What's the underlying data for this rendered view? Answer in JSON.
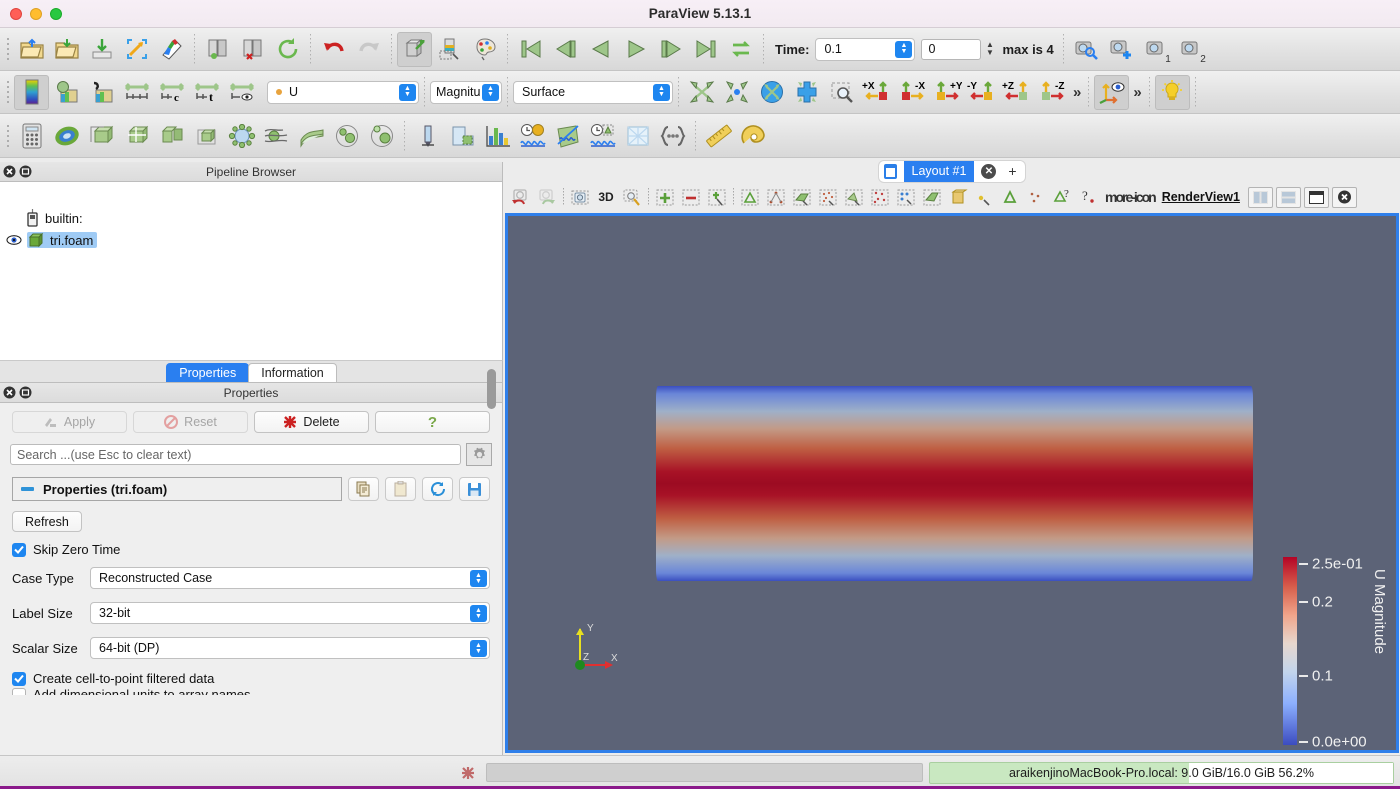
{
  "window": {
    "title": "ParaView 5.13.1"
  },
  "toolbar_main": {
    "time_label": "Time:",
    "time_value": "0.1",
    "frame_value": "0",
    "max_label": "max is 4",
    "camera1_sub": "1",
    "camera2_sub": "2",
    "icons": [
      "open-file-icon",
      "save-data-icon",
      "save-state-icon",
      "load-state-icon",
      "save-screenshot-icon",
      "connect-server-icon",
      "disconnect-server-icon",
      "reset-session-icon",
      "undo-icon",
      "redo-icon",
      "camera-undo-icon",
      "colormap-editor-icon",
      "edit-color-legend-icon",
      "first-frame-icon",
      "previous-frame-icon",
      "play-reverse-icon",
      "play-icon",
      "next-frame-icon",
      "last-frame-icon",
      "loop-icon",
      "magnify-camera-icon",
      "add-camera-icon",
      "camera-1-icon",
      "camera-2-icon"
    ]
  },
  "toolbar_active": {
    "array_value": "U",
    "component_value": "Magnitu",
    "representation_value": "Surface",
    "icons": [
      "color-map-icon",
      "rescale-to-data-icon",
      "rescale-custom-icon",
      "rescale-visible-icon",
      "rescale-over-time-icon",
      "rescale-temporal-icon",
      "rescale-visible-range-icon",
      "reset-camera-icon",
      "zoom-closest-icon",
      "rotate-90-icon",
      "center-axes-icon",
      "zoom-to-box-icon",
      "plus-x-icon",
      "minus-x-icon",
      "plus-y-icon",
      "minus-y-icon",
      "plus-z-icon",
      "minus-z-icon",
      "more-icon",
      "orientation-axes-icon",
      "more2-icon",
      "light-kit-icon"
    ]
  },
  "toolbar_filters": {
    "icons": [
      "calculator-icon",
      "contour-icon",
      "clip-icon",
      "slice-icon",
      "threshold-icon",
      "extract-subset-icon",
      "glyph-icon",
      "stream-tracer-icon",
      "warp-icon",
      "group-datasets-icon",
      "extract-level-icon",
      "probe-location-icon",
      "plot-over-line-icon",
      "histogram-icon",
      "plot-data-over-time-icon",
      "plot-on-intersection-icon",
      "plot-selection-over-time-icon",
      "annotate-time-icon",
      "python-calculator-icon",
      "ruler-icon",
      "protractor-icon"
    ]
  },
  "pipeline": {
    "panel_title": "Pipeline Browser",
    "items": [
      {
        "label": "builtin:",
        "icon": "server-icon",
        "selected": false,
        "eye": false
      },
      {
        "label": "tri.foam",
        "icon": "dataset-icon",
        "selected": true,
        "eye": true
      }
    ]
  },
  "properties": {
    "tabs": [
      {
        "label": "Properties",
        "selected": true
      },
      {
        "label": "Information",
        "selected": false
      }
    ],
    "panel_title": "Properties",
    "buttons": [
      {
        "label": "Apply",
        "icon": "apply-icon",
        "enabled": false
      },
      {
        "label": "Reset",
        "icon": "reset-icon",
        "enabled": false
      },
      {
        "label": "Delete",
        "icon": "delete-icon",
        "enabled": true
      },
      {
        "label": "?",
        "icon": "help-icon",
        "enabled": true
      }
    ],
    "search_placeholder": "Search ...(use Esc to clear text)",
    "gear_icon": "gear-icon",
    "group_title": "Properties (tri.foam)",
    "group_buttons": [
      "copy-icon",
      "paste-icon",
      "restore-defaults-icon",
      "save-defaults-icon"
    ],
    "refresh_label": "Refresh",
    "skip_zero_time": {
      "label": "Skip Zero Time",
      "checked": true
    },
    "fields": [
      {
        "label": "Case Type",
        "value": "Reconstructed Case"
      },
      {
        "label": "Label Size",
        "value": "32-bit"
      },
      {
        "label": "Scalar Size",
        "value": "64-bit (DP)"
      }
    ],
    "create_cell_to_point": {
      "label": "Create cell-to-point filtered data",
      "checked": true
    },
    "partial_row_label": "Add dimensional units to array names"
  },
  "layout": {
    "tab_label": "Layout #1",
    "close_icon": "close-icon",
    "add_icon": "plus-icon"
  },
  "viewtoolbar": {
    "view_name": "RenderView1",
    "mode_3d": "3D",
    "more_icon": "more-icon",
    "icons": [
      "undo-camera-icon",
      "redo-camera-icon",
      "adjust-camera-icon",
      "mode-3d-icon",
      "zoom-to-data-icon",
      "show-center-icon",
      "hide-center-icon",
      "pick-center-icon",
      "select-cells-icon",
      "select-points-icon",
      "select-surface-cells-icon",
      "select-surface-points-icon",
      "select-frustum-cells-icon",
      "select-frustum-points-icon",
      "select-block-icon",
      "interactive-select-icon",
      "hover-points-icon",
      "hover-cells-icon",
      "select-polygon-icon",
      "zoom-help-icon",
      "help-icon"
    ],
    "split_buttons": [
      "split-horizontal-icon",
      "split-vertical-icon",
      "maximize-icon",
      "close-view-icon"
    ]
  },
  "renderview": {
    "background_color": "#5c6377",
    "axes": {
      "x_label": "X",
      "y_label": "Y",
      "z_label": "Z",
      "x_color": "#e03030",
      "y_color": "#e8e020",
      "z_color": "#30b030"
    }
  },
  "scalar_bar": {
    "title": "U Magnitude",
    "tick_labels": [
      "2.5e-01",
      "0.2",
      "0.1",
      "0.0e+00"
    ],
    "tick_positions_pct": [
      3,
      22,
      60,
      97
    ],
    "colormap": "Cool to Warm",
    "min": 0.0,
    "max": 0.25
  },
  "statusbar": {
    "cancel_icon": "cancel-icon",
    "memory_text": "araikenjinoMacBook-Pro.local: 9.0 GiB/16.0 GiB 56.2%"
  },
  "colors": {
    "accent_blue": "#2a7ff0",
    "selection_blue": "#9fcbf5",
    "render_bg": "#5c6377",
    "status_green": "#c9e8c1"
  }
}
